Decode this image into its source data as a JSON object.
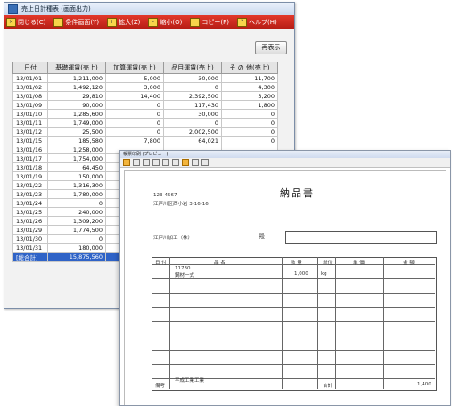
{
  "window1": {
    "title": "売上日計種表 (画面出力)",
    "menu": [
      {
        "label": "閉じる(C)",
        "icon": "close-icon"
      },
      {
        "label": "条件画面(Y)",
        "icon": "conditions-icon"
      },
      {
        "label": "拡大(Z)",
        "icon": "zoom-icon"
      },
      {
        "label": "縮小(O)",
        "icon": "shrink-icon"
      },
      {
        "label": "コピー(P)",
        "icon": "copy-icon"
      },
      {
        "label": "ヘルプ(H)",
        "icon": "help-icon"
      }
    ],
    "redisplay_button": "再表示",
    "table": {
      "headers": [
        "日付",
        "基礎運賃(売上)",
        "加算運賃(売上)",
        "品目運賃(売上)",
        "そ の 他(売上)"
      ],
      "rows": [
        [
          "13/01/01",
          "1,211,000",
          "5,000",
          "30,000",
          "11,700"
        ],
        [
          "13/01/02",
          "1,492,120",
          "3,000",
          "0",
          "4,300"
        ],
        [
          "13/01/08",
          "29,810",
          "14,400",
          "2,392,500",
          "3,200"
        ],
        [
          "13/01/09",
          "90,000",
          "0",
          "117,430",
          "1,800"
        ],
        [
          "13/01/10",
          "1,285,600",
          "0",
          "30,000",
          "0"
        ],
        [
          "13/01/11",
          "1,749,000",
          "0",
          "0",
          "0"
        ],
        [
          "13/01/12",
          "25,500",
          "0",
          "2,002,500",
          "0"
        ],
        [
          "13/01/15",
          "185,580",
          "7,800",
          "64,021",
          "0"
        ],
        [
          "13/01/16",
          "1,258,000",
          "",
          "",
          ""
        ],
        [
          "13/01/17",
          "1,754,000",
          "",
          "",
          ""
        ],
        [
          "13/01/18",
          "64,450",
          "",
          "",
          ""
        ],
        [
          "13/01/19",
          "150,000",
          "",
          "",
          ""
        ],
        [
          "13/01/22",
          "1,316,300",
          "",
          "",
          ""
        ],
        [
          "13/01/23",
          "1,780,000",
          "",
          "",
          ""
        ],
        [
          "13/01/24",
          "0",
          "",
          "",
          ""
        ],
        [
          "13/01/25",
          "240,000",
          "",
          "",
          ""
        ],
        [
          "13/01/26",
          "1,309,200",
          "",
          "",
          ""
        ],
        [
          "13/01/29",
          "1,774,500",
          "",
          "",
          ""
        ],
        [
          "13/01/30",
          "0",
          "",
          "",
          ""
        ],
        [
          "13/01/31",
          "180,000",
          "",
          "",
          ""
        ]
      ],
      "total": [
        "[総合計]",
        "15,875,560",
        "",
        "",
        ""
      ]
    }
  },
  "window2": {
    "title": "帳票印刷 (プレビュー)",
    "doc_title": "納品書",
    "address_lines": [
      "123-4567",
      "江戸川区西小岩 3-16-16"
    ],
    "recipient": "江戸川加工（株）",
    "honorific": "殿",
    "table_headers": [
      "日 付",
      "品 名",
      "数 量",
      "単位",
      "単 価",
      "金 額"
    ],
    "item_code": "11730",
    "item_name": "鋼材一式",
    "item_qty": "1,000",
    "item_unit": "kg",
    "remark_label": "備考",
    "remark_text": "平成工業工業",
    "footer_total_label": "合計",
    "footer_page": "1,400"
  }
}
